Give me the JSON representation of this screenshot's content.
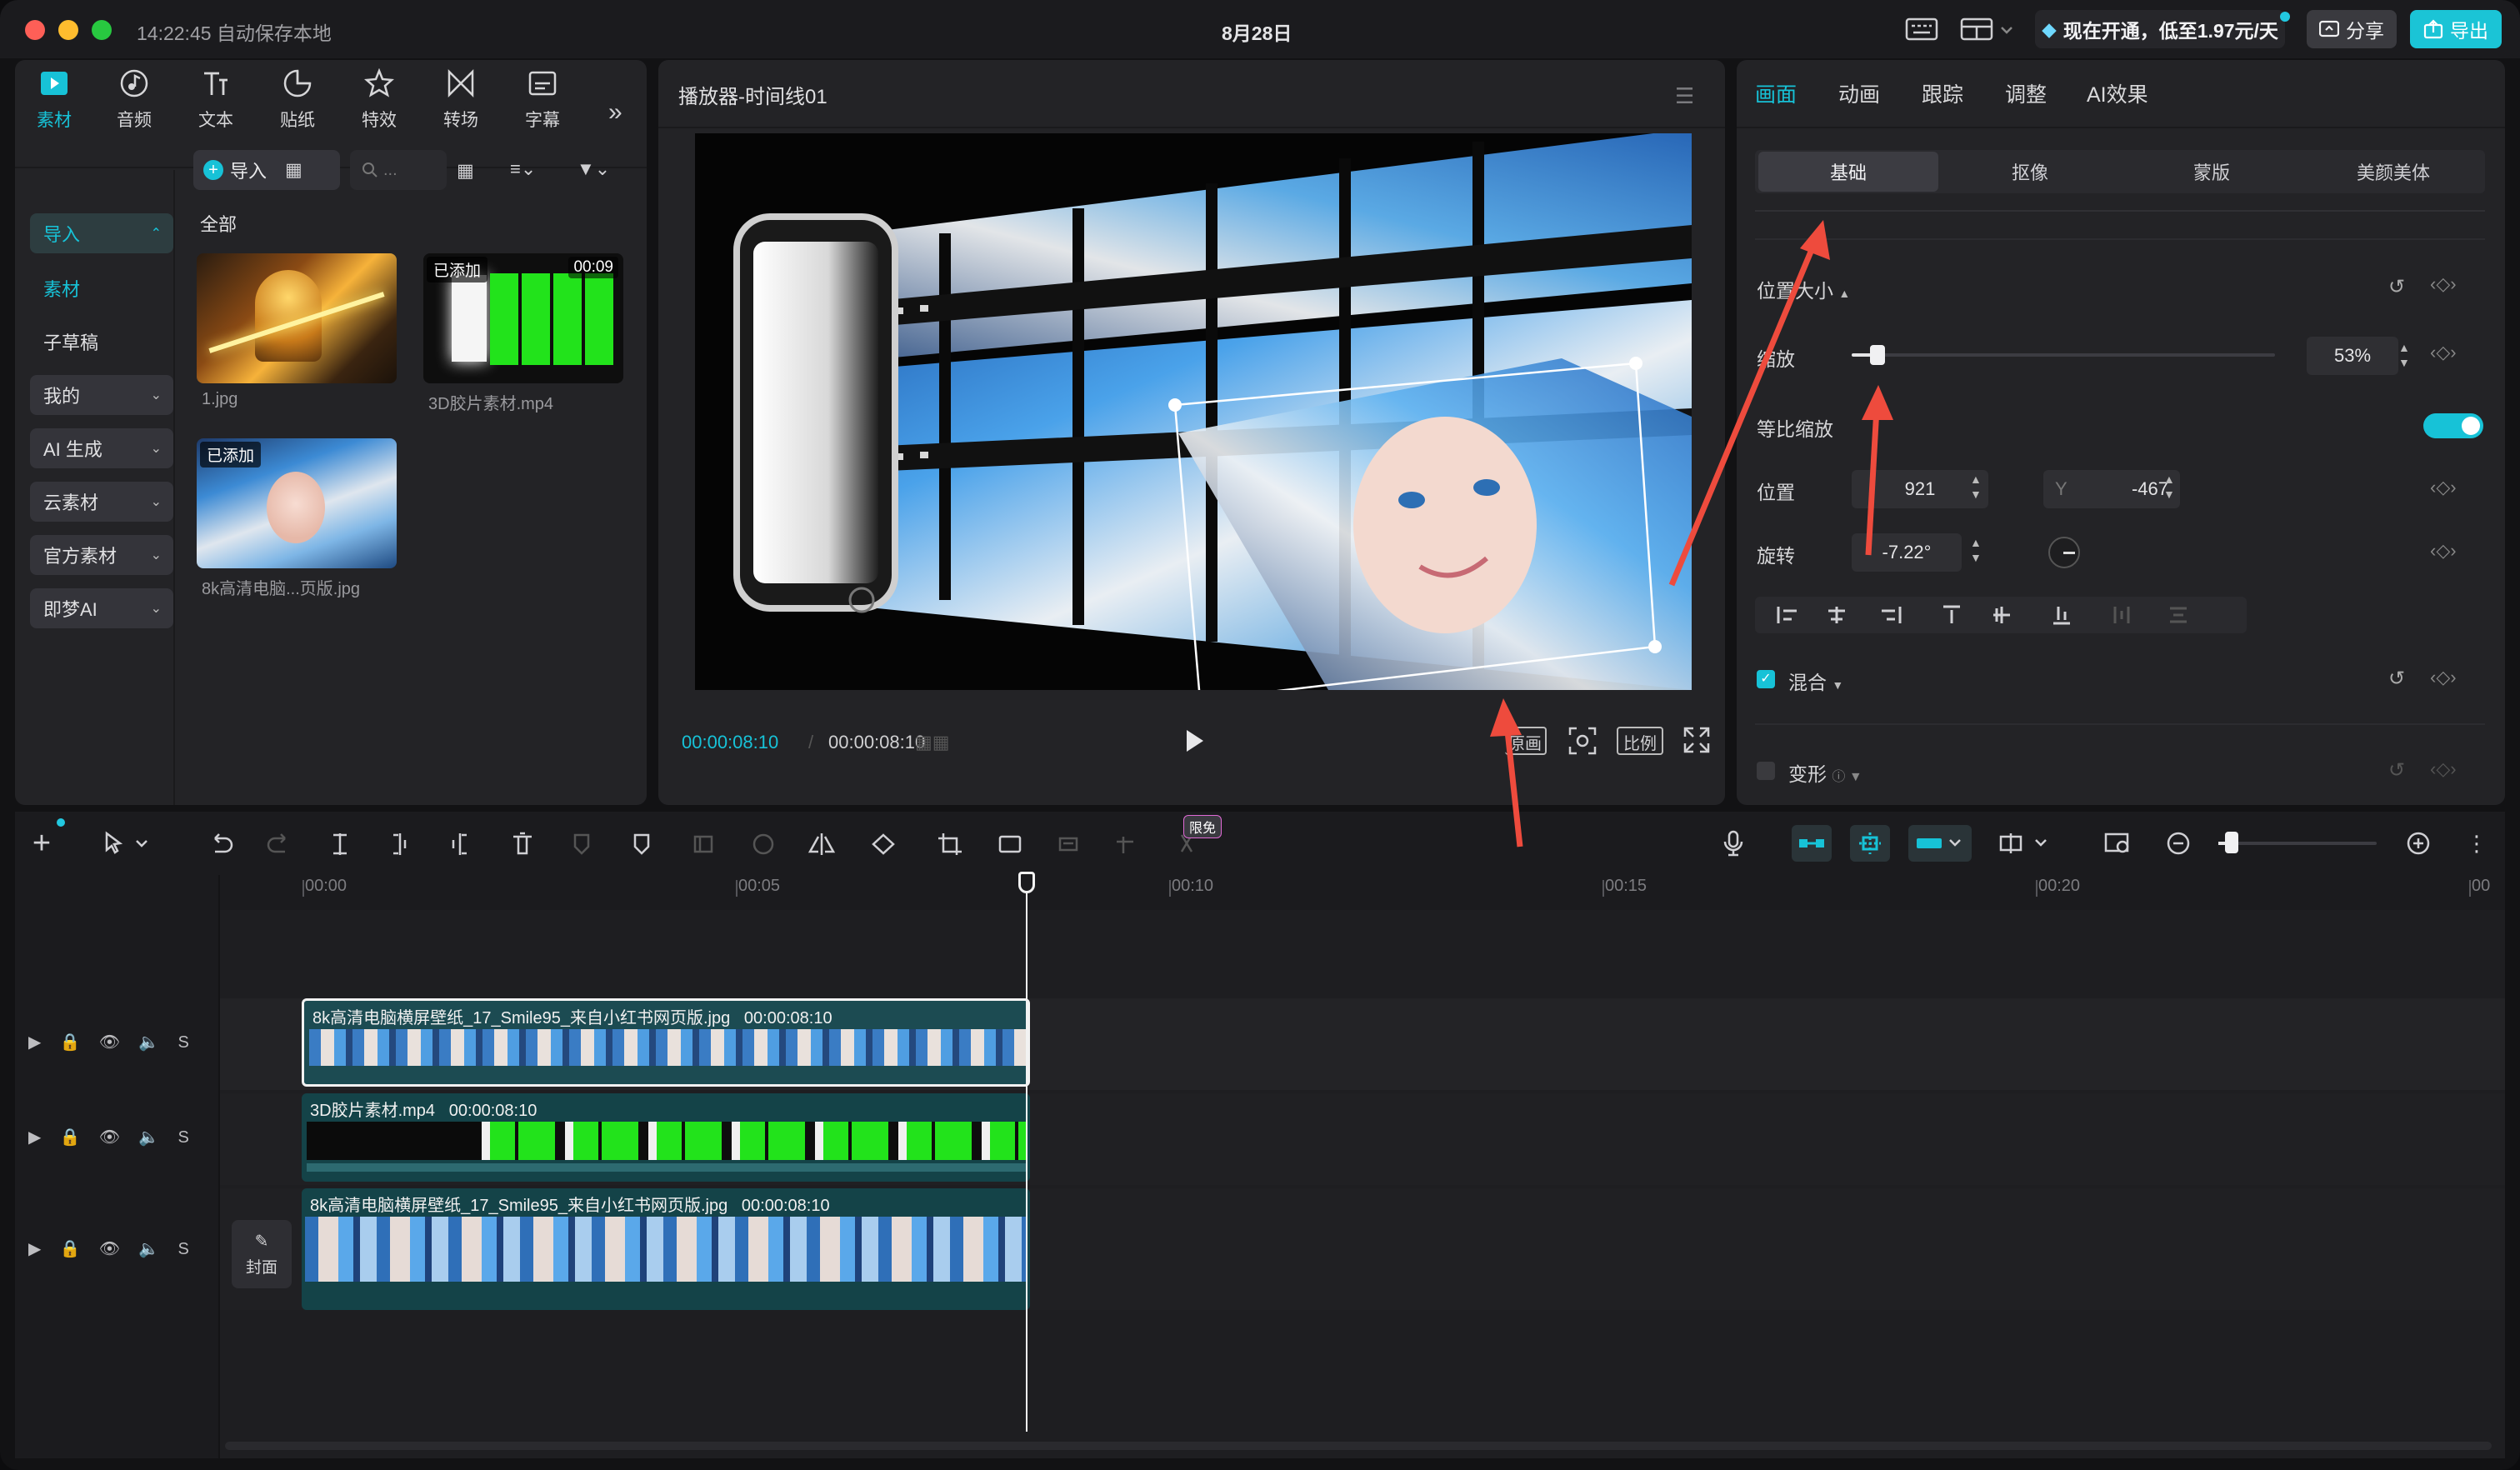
{
  "titlebar": {
    "time_autosave": "14:22:45 自动保存本地",
    "date": "8月28日",
    "promo": "现在开通，低至1.97元/天",
    "share": "分享",
    "export": "导出"
  },
  "media_panel": {
    "tabs": [
      {
        "label": "素材",
        "icon": "media-icon",
        "active": true
      },
      {
        "label": "音频",
        "icon": "audio-icon"
      },
      {
        "label": "文本",
        "icon": "text-icon"
      },
      {
        "label": "贴纸",
        "icon": "sticker-icon"
      },
      {
        "label": "特效",
        "icon": "effects-icon"
      },
      {
        "label": "转场",
        "icon": "transition-icon"
      },
      {
        "label": "字幕",
        "icon": "subtitle-icon"
      }
    ],
    "sidebar": {
      "import": "导入",
      "material": "素材",
      "sub_draft": "子草稿",
      "mine": "我的",
      "ai_gen": "AI 生成",
      "cloud": "云素材",
      "official": "官方素材",
      "jimeng": "即梦AI"
    },
    "import_btn": "导入",
    "search_placeholder": "...",
    "section": "全部",
    "items": [
      {
        "name": "1.jpg",
        "badge": ""
      },
      {
        "name": "3D胶片素材.mp4",
        "badge": "已添加",
        "duration": "00:09"
      },
      {
        "name": "8k高清电脑...页版.jpg",
        "badge": "已添加"
      }
    ]
  },
  "player": {
    "title": "播放器-时间线01",
    "current": "00:00:08:10",
    "total": "00:00:08:10",
    "btn_original": "原画",
    "btn_ratio": "比例"
  },
  "inspector": {
    "tabs": [
      "画面",
      "动画",
      "跟踪",
      "调整",
      "AI效果"
    ],
    "subtabs": [
      "基础",
      "抠像",
      "蒙版",
      "美颜美体"
    ],
    "section_pos_size": "位置大小",
    "scale_label": "缩放",
    "scale_value": "53%",
    "scale_fraction": 0.53,
    "uniform_scale": "等比缩放",
    "position_label": "位置",
    "pos_x": "921",
    "pos_y_label": "Y",
    "pos_y": "-467",
    "rotation_label": "旋转",
    "rotation": "-7.22°",
    "blend": "混合",
    "transform": "变形"
  },
  "toolbar": {
    "free_badge": "限免"
  },
  "timeline": {
    "ticks": [
      "00:00",
      "00:05",
      "00:10",
      "00:15",
      "00:20",
      "00"
    ],
    "cover": "封面",
    "tracks": [
      {
        "title": "8k高清电脑横屏壁纸_17_Smile95_来自小红书网页版.jpg",
        "duration": "00:00:08:10"
      },
      {
        "title": "3D胶片素材.mp4",
        "duration": "00:00:08:10"
      },
      {
        "title": "8k高清电脑横屏壁纸_17_Smile95_来自小红书网页版.jpg",
        "duration": "00:00:08:10"
      }
    ],
    "track_s": "S"
  },
  "colors": {
    "accent": "#17c2d7",
    "panel": "#232326",
    "green_screen": "#22e31b"
  }
}
